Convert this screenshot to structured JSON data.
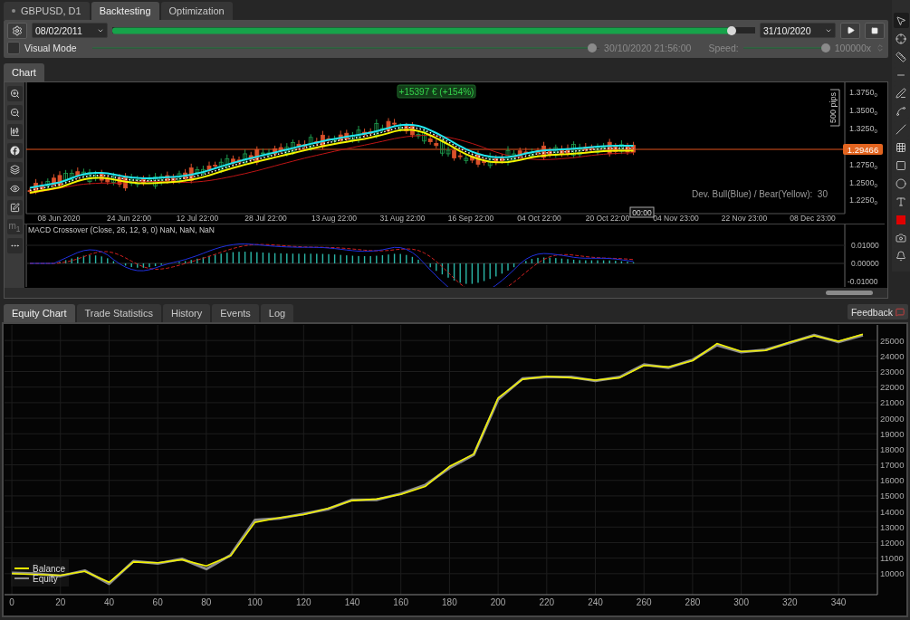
{
  "symbol_tab": {
    "label": "GBPUSD, D1"
  },
  "top_tabs": [
    {
      "label": "Backtesting",
      "selected": true
    },
    {
      "label": "Optimization",
      "selected": false
    }
  ],
  "controls": {
    "start_date": "08/02/2011",
    "progress": {
      "level": 0.97
    },
    "end_date": "31/10/2020",
    "visual_mode": {
      "label": "Visual Mode",
      "checked": false
    },
    "visual_progress": {
      "level": 0.995
    },
    "current_time": "30/10/2020 21:56:00",
    "speed_label": "Speed:",
    "speed": {
      "level": 1
    },
    "speed_value": "100000x"
  },
  "chart_tabs": [
    {
      "label": "Chart",
      "selected": true
    }
  ],
  "chart_tools_label": "m$_{1}$",
  "price_chart": {
    "profit_badge": "+15397 € (+154%)",
    "range_label": "500 pips",
    "current_price": "1.29466",
    "indicator_note": "Dev. Bull(Blue) / Bear(Yellow):  30",
    "cursor_time": "00:00",
    "price_axis": [
      {
        "value": "1.3750",
        "suffix": "0"
      },
      {
        "value": "1.3500",
        "suffix": "0"
      },
      {
        "value": "1.3250",
        "suffix": "0"
      },
      {
        "value": "1.2750",
        "suffix": "0"
      },
      {
        "value": "1.2500",
        "suffix": "0"
      },
      {
        "value": "1.2250",
        "suffix": "0"
      }
    ],
    "dates": [
      "08 Jun 2020",
      "24 Jun 22:00",
      "12 Jul 22:00",
      "28 Jul 22:00",
      "13 Aug 22:00",
      "31 Aug 22:00",
      "16 Sep 22:00",
      "04 Oct 22:00",
      "20 Oct 22:00",
      "04 Nov 23:00",
      "22 Nov 23:00",
      "08 Dec 23:00"
    ]
  },
  "macd": {
    "title": "MACD Crossover (Close, 26, 12, 9, 0) NaN, NaN, NaN",
    "axis": [
      "0.01000",
      "0.00000",
      "-0.01000"
    ]
  },
  "drawing_tools": [
    {
      "kind": "pointer",
      "selected": true
    },
    {
      "kind": "crosshair",
      "selected": false
    },
    {
      "kind": "measure",
      "selected": false
    },
    {
      "kind": "hline",
      "selected": false
    },
    {
      "kind": "pen",
      "selected": false
    },
    {
      "kind": "fan",
      "selected": false
    },
    {
      "kind": "channel",
      "selected": false
    },
    {
      "kind": "grid",
      "selected": false
    },
    {
      "kind": "rectangle",
      "selected": false
    },
    {
      "kind": "ellipse",
      "selected": false
    },
    {
      "kind": "text",
      "selected": false
    },
    {
      "kind": "color",
      "selected": false
    },
    {
      "kind": "camera",
      "selected": false
    },
    {
      "kind": "alert",
      "selected": false
    }
  ],
  "bottom_tabs": [
    {
      "label": "Equity Chart",
      "selected": true
    },
    {
      "label": "Trade Statistics",
      "selected": false
    },
    {
      "label": "History",
      "selected": false
    },
    {
      "label": "Events",
      "selected": false
    },
    {
      "label": "Log",
      "selected": false
    }
  ],
  "feedback_button": "Feedback",
  "equity_chart": {
    "chart_data": {
      "type": "line",
      "x": [
        0,
        10,
        20,
        30,
        40,
        50,
        60,
        70,
        80,
        90,
        100,
        110,
        120,
        130,
        140,
        150,
        160,
        170,
        180,
        190,
        200,
        210,
        220,
        230,
        240,
        250,
        260,
        270,
        280,
        290,
        300,
        310,
        320,
        330,
        340,
        350
      ],
      "series": [
        {
          "name": "Balance",
          "color": "#f2f200",
          "values": [
            10000,
            9950,
            9900,
            10150,
            9450,
            10750,
            10700,
            10900,
            10500,
            11150,
            13300,
            13600,
            13800,
            14200,
            14700,
            14800,
            15100,
            15600,
            16900,
            17700,
            21300,
            22500,
            22700,
            22600,
            22450,
            22600,
            23400,
            23300,
            23700,
            24800,
            24300,
            24350,
            24900,
            25300,
            24950,
            25400
          ]
        },
        {
          "name": "Equity",
          "color": "#8c8c8c",
          "values": [
            10050,
            10000,
            9850,
            10200,
            9350,
            10800,
            10650,
            10950,
            10300,
            11200,
            13450,
            13550,
            13850,
            14150,
            14750,
            14750,
            15150,
            15700,
            16800,
            17650,
            21200,
            22550,
            22650,
            22650,
            22400,
            22650,
            23450,
            23250,
            23750,
            24700,
            24250,
            24400,
            24850,
            25350,
            24900,
            25350
          ]
        }
      ],
      "grid": true,
      "legend": "lower left",
      "xlim": [
        -3,
        356
      ],
      "ylim": [
        8650,
        26000
      ],
      "xticks": [
        0,
        20,
        40,
        60,
        80,
        100,
        120,
        140,
        160,
        180,
        200,
        220,
        240,
        260,
        280,
        300,
        320,
        340
      ],
      "yticks": [
        10000,
        11000,
        12000,
        13000,
        14000,
        15000,
        16000,
        17000,
        18000,
        19000,
        20000,
        21000,
        22000,
        23000,
        24000,
        25000
      ]
    }
  }
}
